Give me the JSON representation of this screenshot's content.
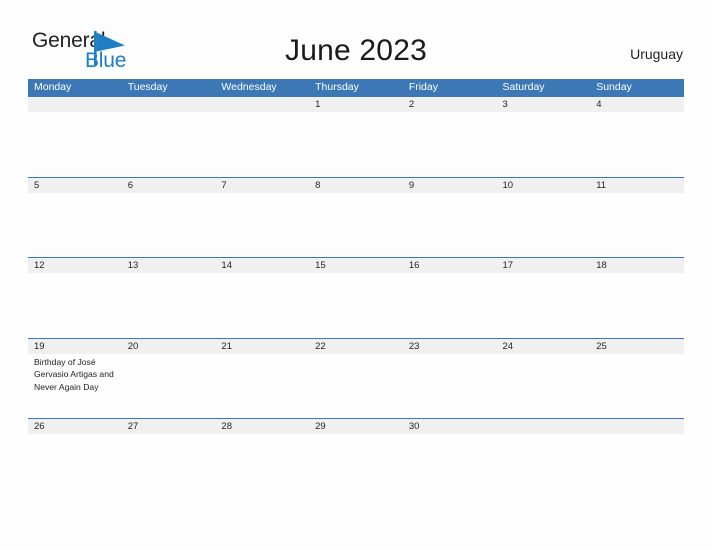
{
  "logo": {
    "word_one": "General",
    "word_two": "Blue",
    "flag_color": "#1f7fc4",
    "text_color": "#231f20"
  },
  "header": {
    "title": "June 2023",
    "region": "Uruguay",
    "header_bg": "#3b78b5",
    "band_bg": "#f0f0f0",
    "page_bg": "#fdfdfd"
  },
  "weekdays": [
    "Monday",
    "Tuesday",
    "Wednesday",
    "Thursday",
    "Friday",
    "Saturday",
    "Sunday"
  ],
  "weeks": [
    {
      "days": [
        {
          "date": "",
          "event": ""
        },
        {
          "date": "",
          "event": ""
        },
        {
          "date": "",
          "event": ""
        },
        {
          "date": "1",
          "event": ""
        },
        {
          "date": "2",
          "event": ""
        },
        {
          "date": "3",
          "event": ""
        },
        {
          "date": "4",
          "event": ""
        }
      ]
    },
    {
      "days": [
        {
          "date": "5",
          "event": ""
        },
        {
          "date": "6",
          "event": ""
        },
        {
          "date": "7",
          "event": ""
        },
        {
          "date": "8",
          "event": ""
        },
        {
          "date": "9",
          "event": ""
        },
        {
          "date": "10",
          "event": ""
        },
        {
          "date": "11",
          "event": ""
        }
      ]
    },
    {
      "days": [
        {
          "date": "12",
          "event": ""
        },
        {
          "date": "13",
          "event": ""
        },
        {
          "date": "14",
          "event": ""
        },
        {
          "date": "15",
          "event": ""
        },
        {
          "date": "16",
          "event": ""
        },
        {
          "date": "17",
          "event": ""
        },
        {
          "date": "18",
          "event": ""
        }
      ]
    },
    {
      "days": [
        {
          "date": "19",
          "event": "Birthday of José Gervasio Artigas and Never Again Day"
        },
        {
          "date": "20",
          "event": ""
        },
        {
          "date": "21",
          "event": ""
        },
        {
          "date": "22",
          "event": ""
        },
        {
          "date": "23",
          "event": ""
        },
        {
          "date": "24",
          "event": ""
        },
        {
          "date": "25",
          "event": ""
        }
      ]
    },
    {
      "days": [
        {
          "date": "26",
          "event": ""
        },
        {
          "date": "27",
          "event": ""
        },
        {
          "date": "28",
          "event": ""
        },
        {
          "date": "29",
          "event": ""
        },
        {
          "date": "30",
          "event": ""
        },
        {
          "date": "",
          "event": ""
        },
        {
          "date": "",
          "event": ""
        }
      ]
    }
  ]
}
